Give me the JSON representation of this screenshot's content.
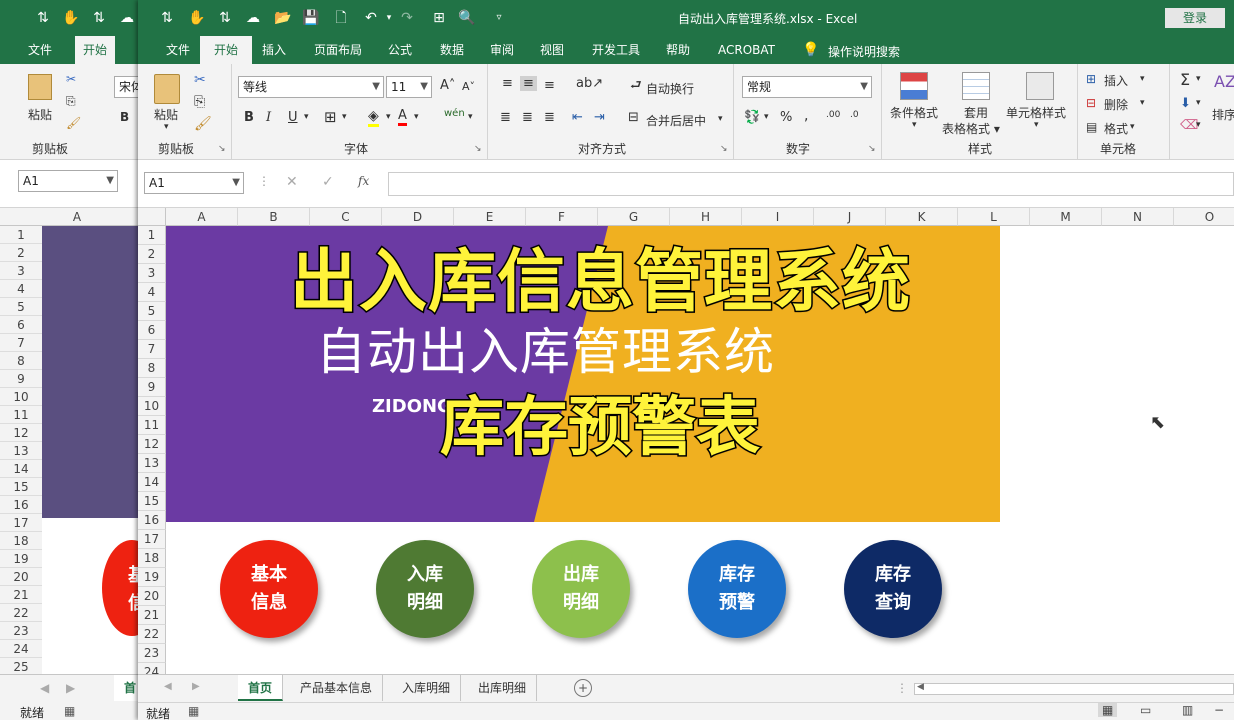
{
  "window": {
    "title": "自动出入库管理系统.xlsx  -  Excel",
    "login": "登录"
  },
  "tabs": [
    "文件",
    "开始",
    "插入",
    "页面布局",
    "公式",
    "数据",
    "审阅",
    "视图",
    "开发工具",
    "帮助",
    "ACROBAT"
  ],
  "active_tab": "开始",
  "tell_me": "操作说明搜索",
  "ribbon": {
    "clipboard": {
      "paste": "粘贴",
      "label": "剪贴板"
    },
    "font": {
      "name": "等线",
      "size": "11",
      "label": "字体",
      "bold": "B",
      "italic": "I",
      "underline": "U"
    },
    "alignment": {
      "wrap": "自动换行",
      "merge": "合并后居中",
      "label": "对齐方式"
    },
    "number": {
      "format": "常规",
      "label": "数字",
      "percent": "%"
    },
    "styles": {
      "conditional": "条件格式",
      "table": "套用\n表格格式",
      "cell": "单元格样式",
      "label": "样式"
    },
    "cells": {
      "insert": "插入",
      "delete": "删除",
      "format": "格式",
      "label": "单元格"
    },
    "editing": {
      "sort": "排序和"
    }
  },
  "formula_bar": {
    "name_box": "A1",
    "fx": "fx",
    "value": ""
  },
  "columns": [
    "A",
    "B",
    "C",
    "D",
    "E",
    "F",
    "G",
    "H",
    "I",
    "J",
    "K",
    "L",
    "M",
    "N",
    "O"
  ],
  "rows": [
    "1",
    "2",
    "3",
    "4",
    "5",
    "6",
    "7",
    "8",
    "9",
    "10",
    "11",
    "12",
    "13",
    "14",
    "15",
    "16",
    "17",
    "18",
    "19",
    "20",
    "21",
    "22",
    "23",
    "24"
  ],
  "banner": {
    "title": "出入库信息管理系统",
    "subtitle": "自动出入库管理系统",
    "en_text": "ZIDONG",
    "overlay": "库存预警表",
    "colors": {
      "purple": "#6b3aa3",
      "orange": "#f0b020",
      "title_yellow": "#fff33a"
    }
  },
  "buttons": [
    {
      "line1": "基本",
      "line2": "信息",
      "color": "#ee2211"
    },
    {
      "line1": "入库",
      "line2": "明细",
      "color": "#4f7a33"
    },
    {
      "line1": "出库",
      "line2": "明细",
      "color": "#8dc04c"
    },
    {
      "line1": "库存",
      "line2": "预警",
      "color": "#1b6fc8"
    },
    {
      "line1": "库存",
      "line2": "查询",
      "color": "#0e2a66"
    }
  ],
  "sheets": [
    "首页",
    "产品基本信息",
    "入库明细",
    "出库明细"
  ],
  "status": "就绪",
  "bg_window": {
    "tabs": [
      "文件",
      "开始"
    ],
    "name_box": "A1",
    "paste": "粘贴",
    "clipboard": "剪贴板",
    "font_preview": "宋体",
    "col": "A",
    "rows": [
      "1",
      "2",
      "3",
      "4",
      "5",
      "6",
      "7",
      "8",
      "9",
      "10",
      "11",
      "12",
      "13",
      "14",
      "15",
      "16",
      "17",
      "18",
      "19",
      "20",
      "21",
      "22",
      "23",
      "24",
      "25"
    ],
    "sheet": "首",
    "status": "就绪",
    "btn_line1": "基",
    "btn_line2": "信"
  }
}
